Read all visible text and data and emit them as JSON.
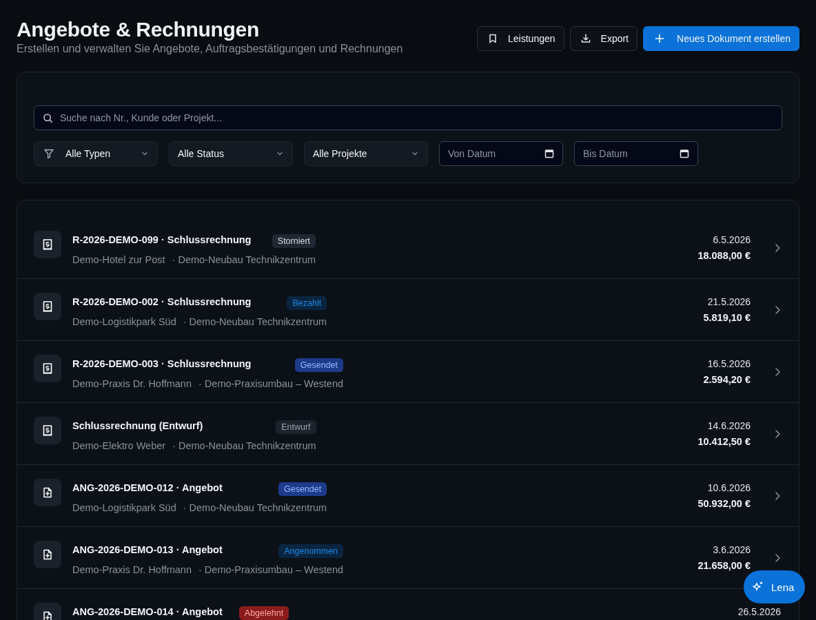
{
  "header": {
    "title": "Angebote & Rechnungen",
    "subtitle": "Erstellen und verwalten Sie Angebote, Auftragsbestätigungen und Rechnungen"
  },
  "actions": [
    {
      "label": "Leistungen",
      "kind": "bookmark"
    },
    {
      "label": "Export",
      "kind": "download"
    },
    {
      "label": "Neues Dokument erstellen",
      "kind": "primary"
    }
  ],
  "filters": {
    "search": {
      "placeholder": "Suche nach Nr., Kunde oder Projekt..."
    },
    "selects": [
      {
        "value": "Alle Typen",
        "kind": "filter"
      },
      {
        "value": "Alle Status",
        "kind": "plain"
      },
      {
        "value": "Alle Projekte",
        "kind": "plain"
      }
    ],
    "dates": [
      {
        "placeholder": "Von Datum"
      },
      {
        "placeholder": "Bis Datum"
      }
    ]
  },
  "documents": [
    {
      "kind": "invoice",
      "title": "R-2026-DEMO-099 · Schlussrechnung",
      "status": {
        "label": "Storniert",
        "kind": "neutral"
      },
      "customer": "Demo-Hotel zur Post",
      "project": "· Demo-Neubau Technikzentrum",
      "date": "6.5.2026",
      "amount": "18.088,00 €"
    },
    {
      "kind": "invoice",
      "title": "R-2026-DEMO-002 · Schlussrechnung",
      "status": {
        "label": "Bezahlt",
        "kind": "info"
      },
      "customer": "Demo-Logistikpark Süd",
      "project": "· Demo-Neubau Technikzentrum",
      "date": "21.5.2026",
      "amount": "5.819,10 €"
    },
    {
      "kind": "invoice",
      "title": "R-2026-DEMO-003 · Schlussrechnung",
      "status": {
        "label": "Gesendet",
        "kind": "primary"
      },
      "customer": "Demo-Praxis Dr. Hoffmann",
      "project": "· Demo-Praxisumbau – Westend",
      "date": "16.5.2026",
      "amount": "2.594,20 €"
    },
    {
      "kind": "invoice",
      "title": "Schlussrechnung (Entwurf)",
      "status": {
        "label": "Entwurf",
        "kind": "muted"
      },
      "customer": "Demo-Elektro Weber",
      "project": "· Demo-Neubau Technikzentrum",
      "date": "14.6.2026",
      "amount": "10.412,50 €"
    },
    {
      "kind": "offer",
      "title": "ANG-2026-DEMO-012 · Angebot",
      "status": {
        "label": "Gesendet",
        "kind": "primary"
      },
      "customer": "Demo-Logistikpark Süd",
      "project": "· Demo-Neubau Technikzentrum",
      "date": "10.6.2026",
      "amount": "50.932,00 €"
    },
    {
      "kind": "offer",
      "title": "ANG-2026-DEMO-013 · Angebot",
      "status": {
        "label": "Angenommen",
        "kind": "info"
      },
      "customer": "Demo-Praxis Dr. Hoffmann",
      "project": "· Demo-Praxisumbau – Westend",
      "date": "3.6.2026",
      "amount": "21.658,00 €"
    },
    {
      "kind": "offer",
      "title": "ANG-2026-DEMO-014 · Angebot",
      "status": {
        "label": "Abgelehnt",
        "kind": "danger"
      },
      "date": "26.5.2026"
    }
  ],
  "assistant": {
    "label": "Lena"
  }
}
